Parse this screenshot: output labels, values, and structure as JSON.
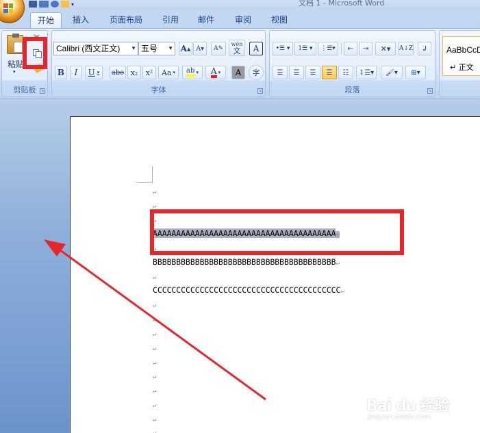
{
  "window": {
    "title": "文档 1 - Microsoft Word"
  },
  "tabs": [
    {
      "label": "开始",
      "active": true
    },
    {
      "label": "插入"
    },
    {
      "label": "页面布局"
    },
    {
      "label": "引用"
    },
    {
      "label": "邮件"
    },
    {
      "label": "审阅"
    },
    {
      "label": "视图"
    }
  ],
  "clipboard": {
    "paste_label": "粘贴",
    "group_label": "剪贴板"
  },
  "font": {
    "name": "Calibri (西文正文)",
    "size": "五号",
    "group_label": "字体",
    "buttons": [
      "B",
      "I",
      "U",
      "abe",
      "x₂",
      "x²",
      "Aa"
    ],
    "grow": "A",
    "shrink": "A",
    "phonetic": "wén",
    "phonetic_char": "文",
    "border_char": "A",
    "shade_char": "A",
    "enclose_char": "字",
    "highlight": "ab",
    "font_color": "A"
  },
  "paragraph": {
    "group_label": "段落"
  },
  "styles": {
    "preview_text": "AaBbCcD",
    "style_name": "↵ 正文"
  },
  "document": {
    "paragraph_mark": "↵",
    "line_a": "AAAAAAAAAAAAAAAAAAAAAAAAAAAAAAAAAAAAAAA",
    "line_b": "BBBBBBBBBBBBBBBBBBBBBBBBBBBBBBBBBBBBBBB",
    "line_c": "CCCCCCCCCCCCCCCCCCCCCCCCCCCCCCCCCCCCCCCC"
  },
  "watermark": {
    "brand": "Bai du 经验",
    "url": "jingyan.baidu.com"
  },
  "colors": {
    "annotation": "#e5262b",
    "selection": "#a9b0c1",
    "ribbon": "#dbe7f7"
  }
}
